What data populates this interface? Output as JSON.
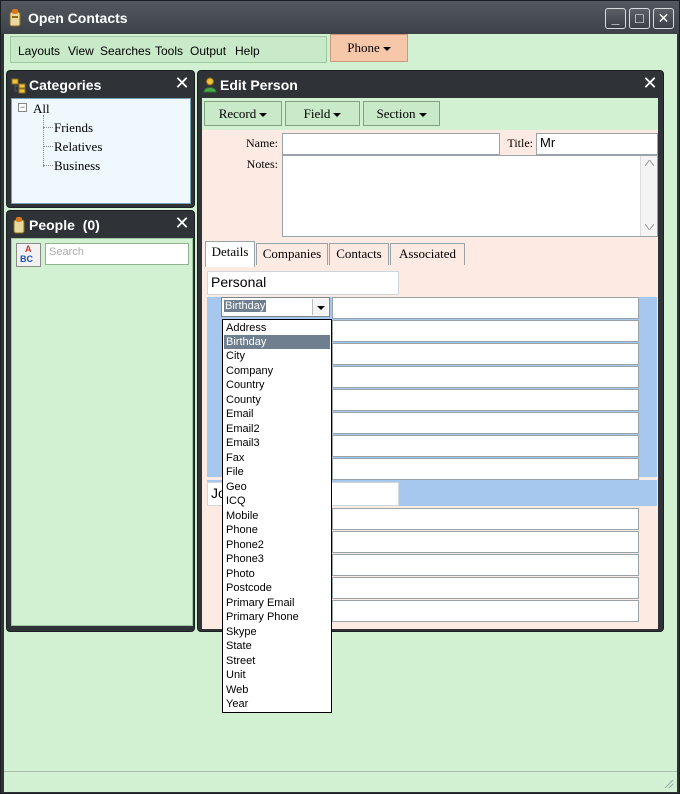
{
  "app": {
    "title": "Open Contacts",
    "window_controls": {
      "minimize": "_",
      "maximize": "□",
      "close": "✕"
    }
  },
  "menu": {
    "items": [
      "Layouts",
      "View",
      "Searches",
      "Tools",
      "Output",
      "Help"
    ],
    "phone_button": "Phone"
  },
  "categories": {
    "title": "Categories",
    "tree": {
      "root": "All",
      "root_expander": "−",
      "children": [
        "Friends",
        "Relatives",
        "Business"
      ]
    }
  },
  "people": {
    "title": "People",
    "count": "(0)",
    "search_placeholder": "Search",
    "sort_label_a": "A",
    "sort_label_bc": "BC"
  },
  "edit_person": {
    "title": "Edit Person",
    "toolbar": {
      "record": "Record",
      "field": "Field",
      "section": "Section"
    },
    "name_label": "Name:",
    "name_value": "",
    "title_label": "Title:",
    "title_value": "Mr",
    "notes_label": "Notes:",
    "notes_value": "",
    "tabs": [
      "Details",
      "Companies",
      "Contacts",
      "Associated"
    ],
    "active_tab": "Details",
    "section_personal": "Personal",
    "section_second_partial": "Jo",
    "field_type_selected": "Birthday"
  },
  "field_type_options": [
    "Address",
    "Birthday",
    "City",
    "Company",
    "Country",
    "County",
    "Email",
    "Email2",
    "Email3",
    "Fax",
    "File",
    "Geo",
    "ICQ",
    "Mobile",
    "Phone",
    "Phone2",
    "Phone3",
    "Photo",
    "Postcode",
    "Primary Email",
    "Primary Phone",
    "Skype",
    "State",
    "Street",
    "Unit",
    "Web",
    "Year"
  ],
  "highlighted_option": "Birthday",
  "colors": {
    "chrome": "#2f3338",
    "panel_bg": "#d2f0d2",
    "edit_bg": "#fdebe3",
    "section_band": "#a6c8ef",
    "accent_button": "#f7c7a9"
  }
}
